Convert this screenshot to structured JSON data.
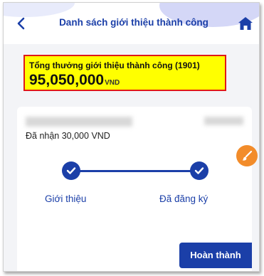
{
  "header": {
    "title": "Danh sách giới thiệu thành công"
  },
  "summary": {
    "label": "Tổng thưởng giới thiệu thành công (1901)",
    "amount": "95,050,000",
    "unit": "VND"
  },
  "card": {
    "received": "Đã nhận 30,000 VND",
    "steps": [
      {
        "label": "Giới thiệu"
      },
      {
        "label": "Đã đăng ký"
      }
    ],
    "done_label": "Hoàn thành"
  },
  "icons": {
    "back": "chevron-left-icon",
    "home": "home-icon",
    "check": "check-icon",
    "float": "brush-icon"
  },
  "colors": {
    "primary": "#1b3fa8",
    "highlight": "#ffff00",
    "highlight_border": "#e01818",
    "accent": "#f28c2a"
  }
}
